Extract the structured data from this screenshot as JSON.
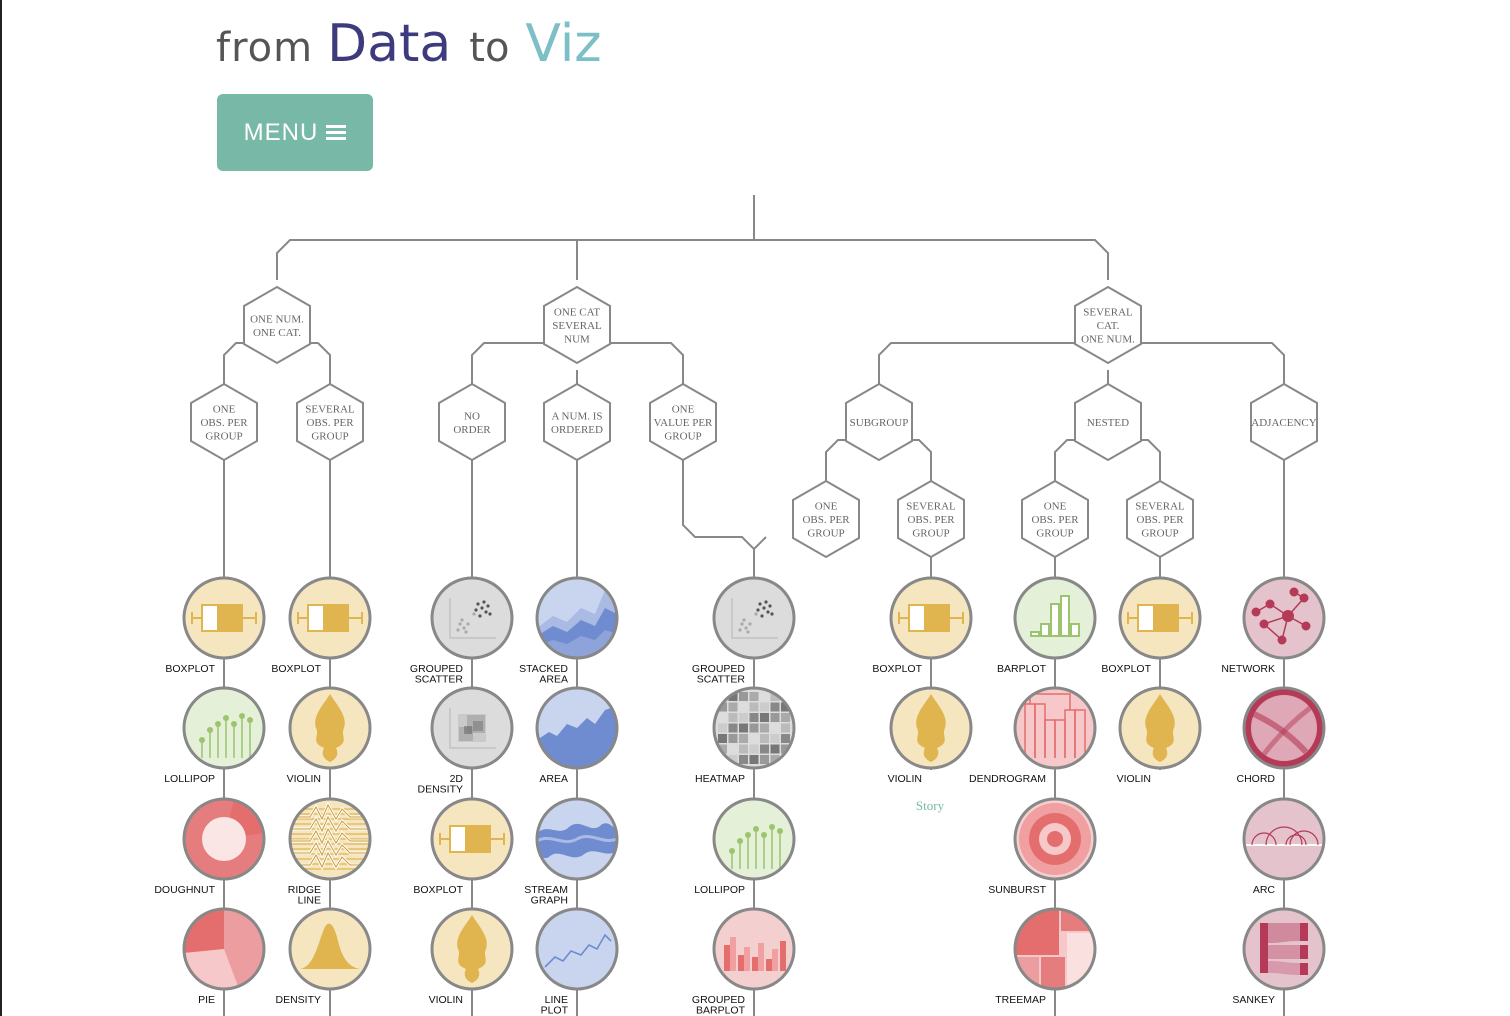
{
  "logo": {
    "from": "from",
    "data": "Data",
    "to": "to",
    "viz": "Viz"
  },
  "menu": {
    "label": "MENU",
    "icon": "hamburger-icon"
  },
  "colors": {
    "menu": "#77b9a6",
    "line": "#888888",
    "yellow": "#f5e6c0",
    "green": "#e5f0d8",
    "gray": "#dcdcdc",
    "blue": "#c9d5ee",
    "red": "#f4cfd0",
    "pink": "#e4c3cc"
  },
  "hexagons": {
    "h1": [
      "ONE NUM.",
      "ONE CAT."
    ],
    "h2": [
      "ONE CAT",
      "SEVERAL",
      "NUM"
    ],
    "h3": [
      "SEVERAL",
      "CAT.",
      "ONE NUM."
    ],
    "h1a": [
      "ONE",
      "OBS. PER",
      "GROUP"
    ],
    "h1b": [
      "SEVERAL",
      "OBS. PER",
      "GROUP"
    ],
    "h2a": [
      "NO",
      "ORDER"
    ],
    "h2b": [
      "A NUM. IS",
      "ORDERED"
    ],
    "h2c": [
      "ONE",
      "VALUE PER",
      "GROUP"
    ],
    "h3a": [
      "SUBGROUP"
    ],
    "h3b": [
      "NESTED"
    ],
    "h3c": [
      "ADJACENCY"
    ],
    "h3a1": [
      "ONE",
      "OBS. PER",
      "GROUP"
    ],
    "h3a2": [
      "SEVERAL",
      "OBS. PER",
      "GROUP"
    ],
    "h3b1": [
      "ONE",
      "OBS. PER",
      "GROUP"
    ],
    "h3b2": [
      "SEVERAL",
      "OBS. PER",
      "GROUP"
    ]
  },
  "columns": {
    "c1": [
      {
        "label": [
          "BOXPLOT"
        ],
        "icon": "boxplot-icon"
      },
      {
        "label": [
          "LOLLIPOP"
        ],
        "icon": "lollipop-icon"
      },
      {
        "label": [
          "DOUGHNUT"
        ],
        "icon": "doughnut-icon"
      },
      {
        "label": [
          "PIE"
        ],
        "icon": "pie-icon"
      }
    ],
    "c2": [
      {
        "label": [
          "BOXPLOT"
        ],
        "icon": "boxplot-icon"
      },
      {
        "label": [
          "VIOLIN"
        ],
        "icon": "violin-icon"
      },
      {
        "label": [
          "RIDGE",
          "LINE"
        ],
        "icon": "ridgeline-icon"
      },
      {
        "label": [
          "DENSITY"
        ],
        "icon": "density-icon"
      }
    ],
    "c3": [
      {
        "label": [
          "GROUPED",
          "SCATTER"
        ],
        "icon": "scatter-icon"
      },
      {
        "label": [
          "2D",
          "DENSITY"
        ],
        "icon": "density-2d-icon"
      },
      {
        "label": [
          "BOXPLOT"
        ],
        "icon": "boxplot-icon"
      },
      {
        "label": [
          "VIOLIN"
        ],
        "icon": "violin-icon"
      }
    ],
    "c4": [
      {
        "label": [
          "STACKED",
          "AREA"
        ],
        "icon": "stacked-area-icon"
      },
      {
        "label": [
          "AREA"
        ],
        "icon": "area-icon"
      },
      {
        "label": [
          "STREAM",
          "GRAPH"
        ],
        "icon": "streamgraph-icon"
      },
      {
        "label": [
          "LINE",
          "PLOT"
        ],
        "icon": "line-plot-icon"
      }
    ],
    "c5": [
      {
        "label": [
          "GROUPED",
          "SCATTER"
        ],
        "icon": "scatter-icon"
      },
      {
        "label": [
          "HEATMAP"
        ],
        "icon": "heatmap-icon"
      },
      {
        "label": [
          "LOLLIPOP"
        ],
        "icon": "lollipop-icon"
      },
      {
        "label": [
          "GROUPED",
          "BARPLOT"
        ],
        "icon": "grouped-barplot-icon"
      }
    ],
    "c6": [
      {
        "label": [
          "BOXPLOT"
        ],
        "icon": "boxplot-icon"
      },
      {
        "label": [
          "VIOLIN"
        ],
        "icon": "violin-icon"
      }
    ],
    "c7": [
      {
        "label": [
          "BARPLOT"
        ],
        "icon": "barplot-icon"
      },
      {
        "label": [
          "DENDROGRAM"
        ],
        "icon": "dendrogram-icon"
      },
      {
        "label": [
          "SUNBURST"
        ],
        "icon": "sunburst-icon"
      },
      {
        "label": [
          "TREEMAP"
        ],
        "icon": "treemap-icon"
      }
    ],
    "c8": [
      {
        "label": [
          "BOXPLOT"
        ],
        "icon": "boxplot-icon"
      },
      {
        "label": [
          "VIOLIN"
        ],
        "icon": "violin-icon"
      }
    ],
    "c9": [
      {
        "label": [
          "NETWORK"
        ],
        "icon": "network-icon"
      },
      {
        "label": [
          "CHORD"
        ],
        "icon": "chord-icon"
      },
      {
        "label": [
          "ARC"
        ],
        "icon": "arc-icon"
      },
      {
        "label": [
          "SANKEY"
        ],
        "icon": "sankey-icon"
      }
    ]
  },
  "story_label": "Story"
}
